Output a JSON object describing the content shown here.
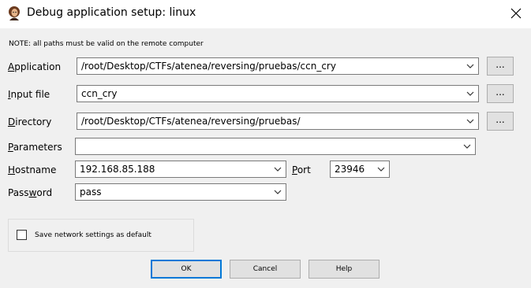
{
  "window": {
    "title": "Debug application setup: linux",
    "close_icon": "close-icon",
    "app_icon": "ida-app-icon"
  },
  "note": "NOTE: all paths must be valid on the remote computer",
  "fields": {
    "application": {
      "label_mn": "A",
      "label_rest": "pplication",
      "value": "/root/Desktop/CTFs/atenea/reversing/pruebas/ccn_cry",
      "browse_label": "..."
    },
    "input_file": {
      "label_mn": "I",
      "label_rest": "nput file",
      "value": "ccn_cry",
      "browse_label": "..."
    },
    "directory": {
      "label_mn": "D",
      "label_rest": "irectory",
      "value": "/root/Desktop/CTFs/atenea/reversing/pruebas/",
      "browse_label": "..."
    },
    "parameters": {
      "label_mn": "P",
      "label_rest": "arameters",
      "value": ""
    },
    "hostname": {
      "label_mn": "H",
      "label_rest": "ostname",
      "value": "192.168.85.188"
    },
    "port": {
      "label_mn": "P",
      "label_rest": "ort",
      "value": "23946"
    },
    "password": {
      "label_pre": "Pass",
      "label_mn": "w",
      "label_rest": "ord",
      "value": "pass"
    }
  },
  "save_settings": {
    "label": "Save network settings as default",
    "checked": false
  },
  "buttons": {
    "ok": "OK",
    "cancel": "Cancel",
    "help": "Help"
  }
}
